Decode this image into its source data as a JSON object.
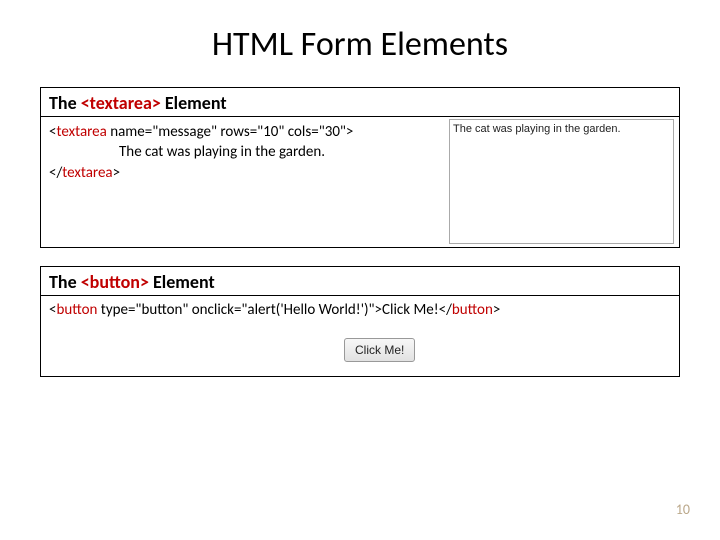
{
  "title": "HTML Form Elements",
  "section1": {
    "heading_pre": "The ",
    "heading_tag": "<textarea>",
    "heading_post": " Element",
    "code_line1_pre": "<",
    "code_line1_tag": "textarea",
    "code_line1_attrs": " name=\"message\" rows=\"10\" cols=\"30\">",
    "code_line2": "The cat was playing in the garden.",
    "code_line3_pre": "</",
    "code_line3_tag": "textarea",
    "code_line3_post": ">",
    "rendered_value": "The cat was playing in the garden."
  },
  "section2": {
    "heading_pre": "The ",
    "heading_tag": "<button>",
    "heading_post": " Element",
    "code_line_pre": "<",
    "code_tag_open": "button",
    "code_attrs": " type=\"button\" onclick=\"alert('Hello World!')\">",
    "code_inner": "Click Me!",
    "code_close_pre": "</",
    "code_tag_close": "button",
    "code_close_post": ">",
    "button_label": "Click Me!"
  },
  "page_number": "10"
}
